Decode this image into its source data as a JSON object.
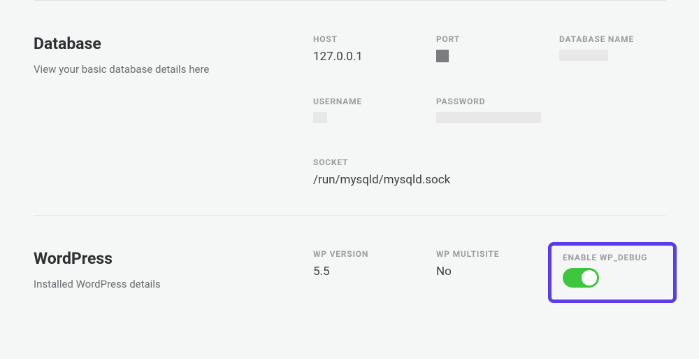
{
  "database": {
    "title": "Database",
    "description": "View your basic database details here",
    "fields": {
      "host": {
        "label": "HOST",
        "value": "127.0.0.1"
      },
      "port": {
        "label": "PORT"
      },
      "dbname": {
        "label": "DATABASE NAME"
      },
      "username": {
        "label": "USERNAME"
      },
      "password": {
        "label": "PASSWORD"
      },
      "socket": {
        "label": "SOCKET",
        "value": "/run/mysqld/mysqld.sock"
      }
    }
  },
  "wordpress": {
    "title": "WordPress",
    "description": "Installed WordPress details",
    "fields": {
      "version": {
        "label": "WP VERSION",
        "value": "5.5"
      },
      "multisite": {
        "label": "WP MULTISITE",
        "value": "No"
      },
      "wp_debug": {
        "label": "ENABLE WP_DEBUG",
        "enabled": true
      }
    }
  }
}
